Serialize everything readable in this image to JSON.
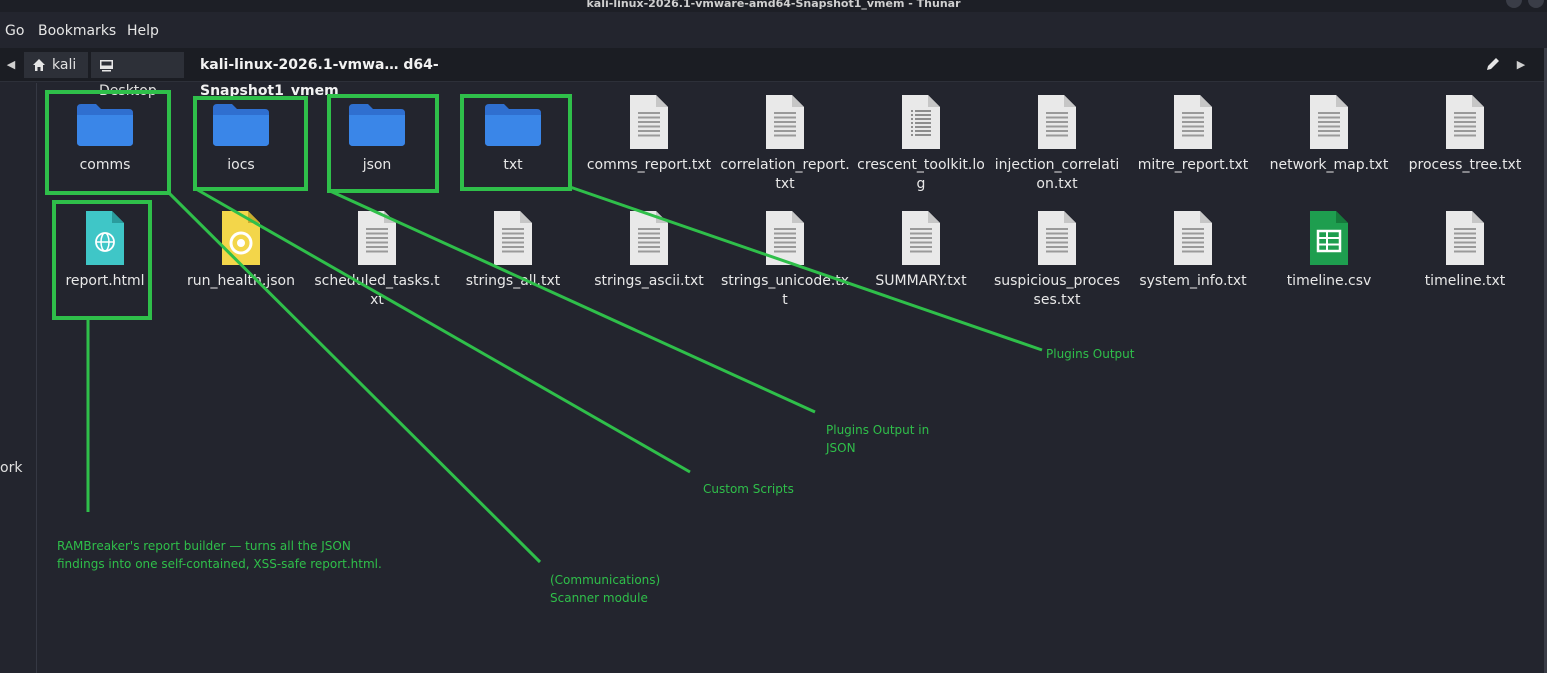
{
  "window": {
    "title": "kali-linux-2026.1-vmware-amd64-Snapshot1_vmem - Thunar"
  },
  "menu": [
    "Go",
    "Bookmarks",
    "Help"
  ],
  "location": {
    "crumbs": [
      "kali",
      "Desktop",
      "kali-linux-2026.1-vmwa… d64-Snapshot1_vmem"
    ]
  },
  "sidebar": {
    "partial_label": "ork"
  },
  "files": [
    {
      "name": "comms",
      "type": "folder"
    },
    {
      "name": "iocs",
      "type": "folder"
    },
    {
      "name": "json",
      "type": "folder"
    },
    {
      "name": "txt",
      "type": "folder"
    },
    {
      "name": "comms_report.txt",
      "type": "text"
    },
    {
      "name": "correlation_report.txt",
      "type": "text"
    },
    {
      "name": "crescent_toolkit.log",
      "type": "log"
    },
    {
      "name": "injection_correlation.txt",
      "type": "text"
    },
    {
      "name": "mitre_report.txt",
      "type": "text"
    },
    {
      "name": "network_map.txt",
      "type": "text"
    },
    {
      "name": "process_tree.txt",
      "type": "text"
    },
    {
      "name": "report.html",
      "type": "html"
    },
    {
      "name": "run_health.json",
      "type": "json"
    },
    {
      "name": "scheduled_tasks.txt",
      "type": "text"
    },
    {
      "name": "strings_all.txt",
      "type": "text"
    },
    {
      "name": "strings_ascii.txt",
      "type": "text"
    },
    {
      "name": "strings_unicode.txt",
      "type": "text"
    },
    {
      "name": "SUMMARY.txt",
      "type": "text"
    },
    {
      "name": "suspicious_processes.txt",
      "type": "text"
    },
    {
      "name": "system_info.txt",
      "type": "text"
    },
    {
      "name": "timeline.csv",
      "type": "csv"
    },
    {
      "name": "timeline.txt",
      "type": "text"
    }
  ],
  "annotations": {
    "plugins_output": "Plugins Output",
    "plugins_output_json_1": "Plugins Output in",
    "plugins_output_json_2": "JSON",
    "custom_scripts": "Custom Scripts",
    "comms_scanner_1": "(Communications)",
    "comms_scanner_2": "Scanner module",
    "report_builder_1": "RAMBreaker's report builder — turns all the JSON",
    "report_builder_2": "findings into one self-contained, XSS-safe report.html."
  },
  "colors": {
    "annotation": "#2fbf4a",
    "folder": "#3a7bd9",
    "background": "#23252e"
  }
}
